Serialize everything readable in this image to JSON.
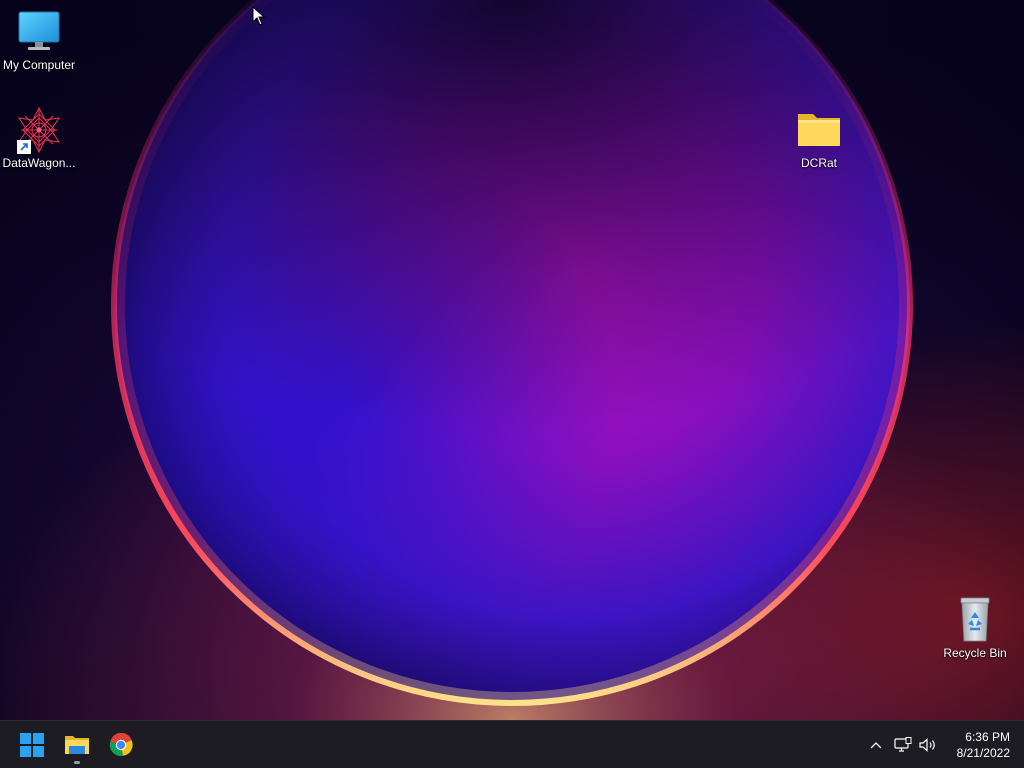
{
  "desktop": {
    "icons": [
      {
        "label": "My Computer",
        "icon": "monitor-icon"
      },
      {
        "label": "DataWagon...",
        "icon": "datawagon-shortcut-icon"
      },
      {
        "label": "DCRat",
        "icon": "folder-icon"
      },
      {
        "label": "Recycle Bin",
        "icon": "recycle-bin-icon"
      }
    ],
    "wallpaper": "windows-11-bloom",
    "colors": {
      "background": "#0a0420",
      "bloom_center": "#a20fb8",
      "bloom_blue": "#2a14c8",
      "rim": "#ff3a5e",
      "rim_glow": "#ffd27a"
    }
  },
  "taskbar": {
    "background": "#1c1c22",
    "pinned": [
      {
        "name": "Start",
        "icon": "windows-start-icon"
      },
      {
        "name": "File Explorer",
        "icon": "file-explorer-icon"
      },
      {
        "name": "Google Chrome",
        "icon": "chrome-icon"
      }
    ],
    "tray": {
      "overflow_icon": "chevron-up-icon",
      "network_icon": "network-icon",
      "volume_icon": "speaker-icon"
    },
    "clock": {
      "time": "6:36 PM",
      "date": "8/21/2022"
    }
  }
}
